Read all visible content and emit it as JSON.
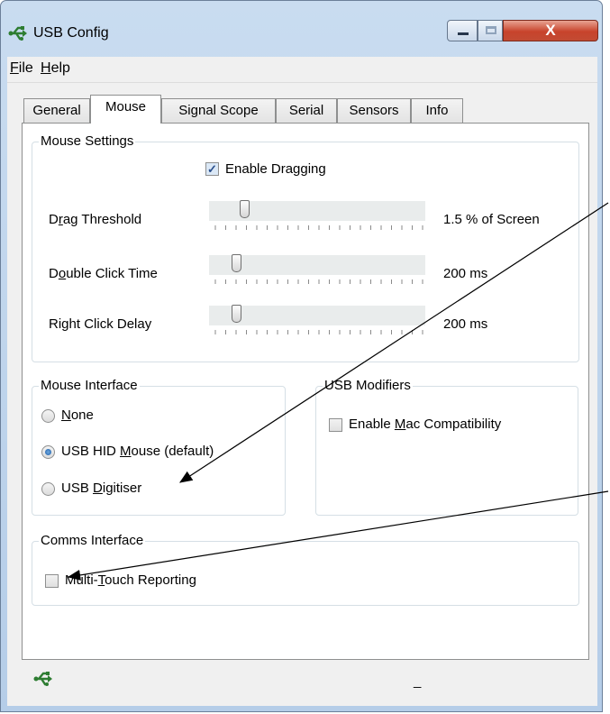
{
  "window": {
    "title": "USB Config",
    "close_glyph": "X"
  },
  "menu": [
    {
      "label_u": "F",
      "label_rest": "ile"
    },
    {
      "label_u": "H",
      "label_rest": "elp"
    }
  ],
  "tabs": [
    "General",
    "Mouse",
    "Signal Scope",
    "Serial",
    "Sensors",
    "Info"
  ],
  "active_tab": "Mouse",
  "mouse_settings": {
    "legend": "Mouse Settings",
    "enable_dragging": {
      "label": "Enable Dragging",
      "checked": true
    },
    "sliders": [
      {
        "label_pre": "D",
        "label_u": "r",
        "label_post": "ag Threshold",
        "value": "1.5 % of Screen",
        "level": 0.14
      },
      {
        "label_pre": "D",
        "label_u": "o",
        "label_post": "uble Click Time",
        "value": "200 ms",
        "level": 0.1
      },
      {
        "label_pre": "Ri",
        "label_u": "g",
        "label_post": "ht Click Delay",
        "value": "200 ms",
        "level": 0.1
      }
    ]
  },
  "mouse_interface": {
    "legend": "Mouse Interface",
    "options": [
      {
        "pre": "",
        "u": "N",
        "post": "one",
        "selected": false
      },
      {
        "pre": "USB HID ",
        "u": "M",
        "post": "ouse (default)",
        "selected": true
      },
      {
        "pre": "USB ",
        "u": "D",
        "post": "igitiser",
        "selected": false
      }
    ]
  },
  "usb_modifiers": {
    "legend": "USB Modifiers",
    "mac": {
      "pre": "Enable ",
      "u": "M",
      "post": "ac Compatibility",
      "checked": false
    }
  },
  "comms_interface": {
    "legend": "Comms Interface",
    "multitouch": {
      "pre": "Multi-",
      "u": "T",
      "post": "ouch Reporting",
      "checked": false
    }
  },
  "status_bar": {
    "text": "_"
  },
  "icons": [
    "usb-icon"
  ],
  "colors": {
    "title_bg": "#c9dcf0",
    "close_red": "#c8432c",
    "panel_bg": "#f0f0f0"
  }
}
